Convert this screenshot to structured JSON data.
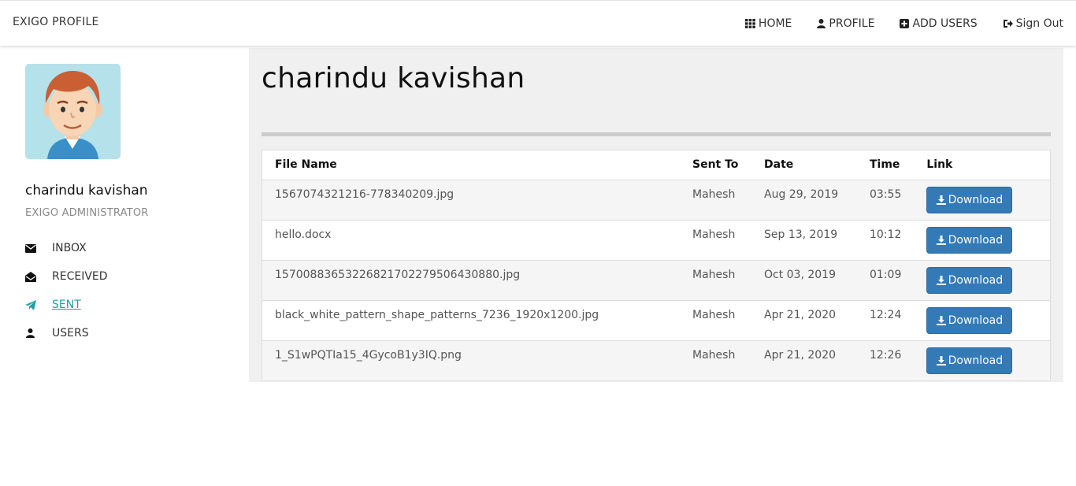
{
  "navbar": {
    "brand": "EXIGO PROFILE",
    "links": [
      {
        "label": "HOME",
        "icon": "grid-icon"
      },
      {
        "label": "PROFILE",
        "icon": "user-icon"
      },
      {
        "label": "ADD USERS",
        "icon": "plus-square-icon"
      },
      {
        "label": "Sign Out",
        "icon": "sign-out-icon"
      }
    ]
  },
  "sidebar": {
    "name": "charindu kavishan",
    "role": "EXIGO ADMINISTRATOR",
    "menu": [
      {
        "label": "INBOX",
        "icon": "envelope-icon",
        "active": false
      },
      {
        "label": "RECEIVED",
        "icon": "envelope-open-icon",
        "active": false
      },
      {
        "label": "SENT",
        "icon": "paper-plane-icon",
        "active": true
      },
      {
        "label": "USERS",
        "icon": "user-icon",
        "active": false
      }
    ],
    "active_color": "#1aa3a3"
  },
  "main": {
    "title": "charindu kavishan",
    "table": {
      "headers": [
        "File Name",
        "Sent To",
        "Date",
        "Time",
        "Link"
      ],
      "rows": [
        {
          "file": "1567074321216-778340209.jpg",
          "sent_to": "Mahesh",
          "date": "Aug 29, 2019",
          "time": "03:55",
          "link": "Download"
        },
        {
          "file": "hello.docx",
          "sent_to": "Mahesh",
          "date": "Sep 13, 2019",
          "time": "10:12",
          "link": "Download"
        },
        {
          "file": "15700883653226821702279506430880.jpg",
          "sent_to": "Mahesh",
          "date": "Oct 03, 2019",
          "time": "01:09",
          "link": "Download"
        },
        {
          "file": "black_white_pattern_shape_patterns_7236_1920x1200.jpg",
          "sent_to": "Mahesh",
          "date": "Apr 21, 2020",
          "time": "12:24",
          "link": "Download"
        },
        {
          "file": "1_S1wPQTIa15_4GycoB1y3IQ.png",
          "sent_to": "Mahesh",
          "date": "Apr 21, 2020",
          "time": "12:26",
          "link": "Download"
        }
      ]
    },
    "button_color": "#337ab7"
  }
}
